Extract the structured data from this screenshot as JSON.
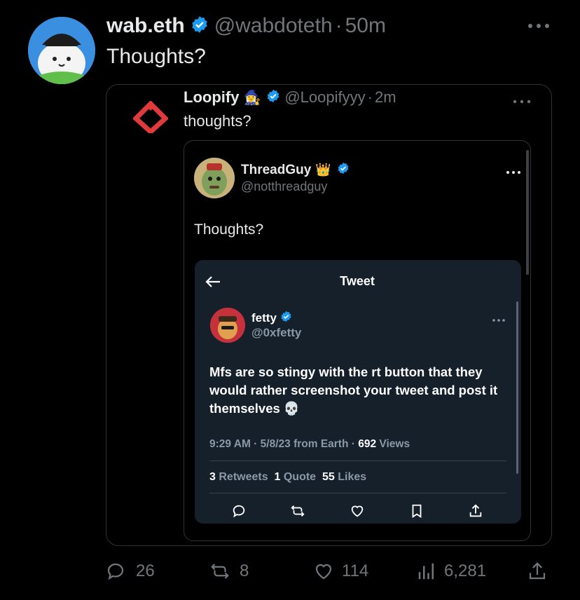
{
  "outer_tweet": {
    "name": "wab.eth",
    "handle": "@wabdoteth",
    "separator": "·",
    "time": "50m",
    "text": "Thoughts?",
    "replies": "26",
    "retweets": "8",
    "likes": "114",
    "views": "6,281"
  },
  "quoted_tweet": {
    "name": "Loopify",
    "name_emoji": "🧙‍♀️",
    "handle": "@Loopifyyy",
    "separator": "·",
    "time": "2m",
    "text": "thoughts?"
  },
  "inner_tweet": {
    "name": "ThreadGuy",
    "name_emoji": "👑",
    "handle": "@notthreadguy",
    "text": "Thoughts?"
  },
  "screenshot": {
    "header_title": "Tweet",
    "name": "fetty",
    "handle": "@0xfetty",
    "text": "Mfs are so stingy with the rt button that they would rather screenshot your tweet and post it themselves 💀",
    "time": "9:29 AM",
    "date": "5/8/23",
    "source": "from Earth",
    "views_count": "692",
    "views_label": "Views",
    "retweets_count": "3",
    "retweets_label": "Retweets",
    "quotes_count": "1",
    "quotes_label": "Quote",
    "likes_count": "55",
    "likes_label": "Likes"
  },
  "colors": {
    "background": "#000000",
    "verified_blue": "#1d9bf0",
    "dim_card": "#15202b",
    "muted_text": "#71767b"
  },
  "icons": [
    "verified-badge-icon",
    "more-icon",
    "back-arrow-icon",
    "reply-icon",
    "retweet-icon",
    "like-icon",
    "bookmark-icon",
    "share-icon",
    "views-icon"
  ]
}
